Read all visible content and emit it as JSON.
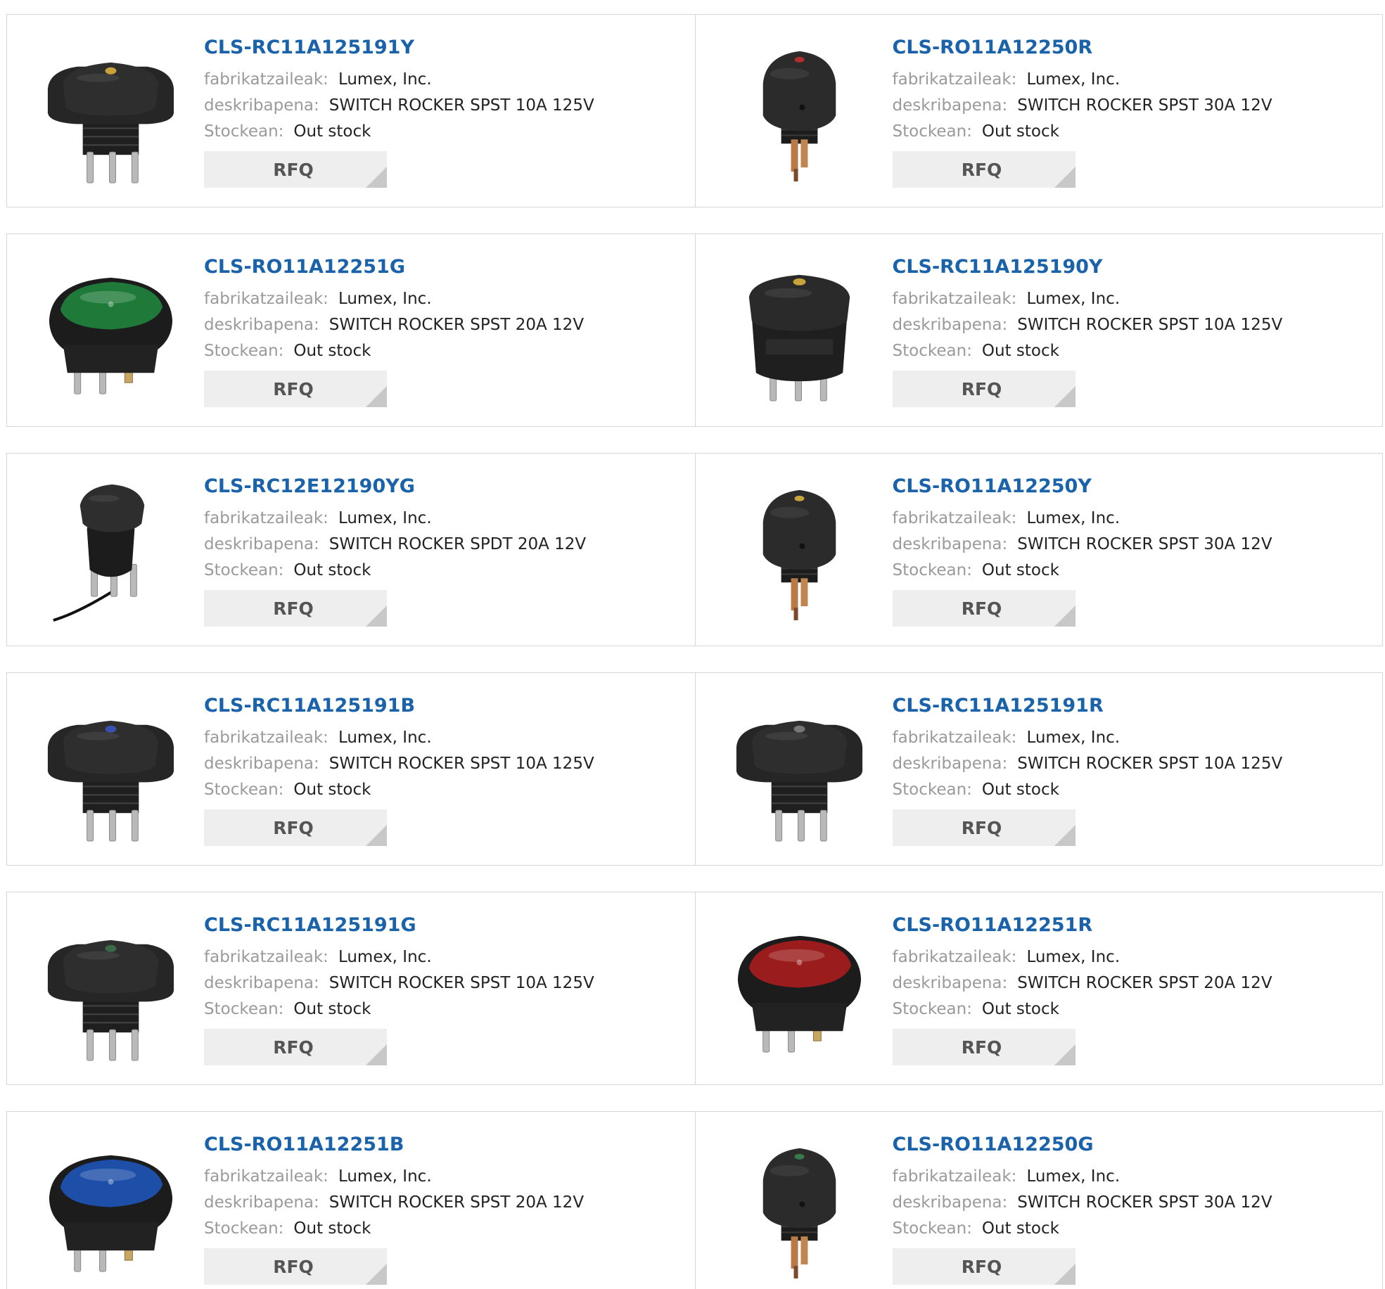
{
  "labels": {
    "manufacturer": "fabrikatzaileak:",
    "description": "deskribapena:",
    "stock": "Stockean:",
    "rfq": "RFQ"
  },
  "products": [
    {
      "part": "CLS-RC11A125191Y",
      "manufacturer": "Lumex, Inc.",
      "description": "SWITCH ROCKER SPST 10A 125V",
      "stock": "Out stock",
      "image": {
        "style": "round-bezel",
        "rocker_color": "#2e2e2e",
        "indicator": "#c8a23a"
      }
    },
    {
      "part": "CLS-RO11A12250R",
      "manufacturer": "Lumex, Inc.",
      "description": "SWITCH ROCKER SPST 30A 12V",
      "stock": "Out stock",
      "image": {
        "style": "oval-small",
        "rocker_color": "#2b2b2b",
        "indicator": "#b03030"
      }
    },
    {
      "part": "CLS-RO11A12251G",
      "manufacturer": "Lumex, Inc.",
      "description": "SWITCH ROCKER SPST 20A 12V",
      "stock": "Out stock",
      "image": {
        "style": "oval-lit",
        "rocker_color": "#1f7a3a",
        "indicator": "#1f7a3a"
      }
    },
    {
      "part": "CLS-RC11A125190Y",
      "manufacturer": "Lumex, Inc.",
      "description": "SWITCH ROCKER SPST 10A 125V",
      "stock": "Out stock",
      "image": {
        "style": "round-body",
        "rocker_color": "#2e2e2e",
        "indicator": "#c8a23a"
      }
    },
    {
      "part": "CLS-RC12E12190YG",
      "manufacturer": "Lumex, Inc.",
      "description": "SWITCH ROCKER SPDT 20A 12V",
      "stock": "Out stock",
      "image": {
        "style": "round-wire",
        "rocker_color": "#2e2e2e",
        "indicator": "#2e2e2e"
      }
    },
    {
      "part": "CLS-RO11A12250Y",
      "manufacturer": "Lumex, Inc.",
      "description": "SWITCH ROCKER SPST 30A 12V",
      "stock": "Out stock",
      "image": {
        "style": "oval-small",
        "rocker_color": "#2b2b2b",
        "indicator": "#c8a23a"
      }
    },
    {
      "part": "CLS-RC11A125191B",
      "manufacturer": "Lumex, Inc.",
      "description": "SWITCH ROCKER SPST 10A 125V",
      "stock": "Out stock",
      "image": {
        "style": "round-bezel",
        "rocker_color": "#2e2e2e",
        "indicator": "#3a4fae"
      }
    },
    {
      "part": "CLS-RC11A125191R",
      "manufacturer": "Lumex, Inc.",
      "description": "SWITCH ROCKER SPST 10A 125V",
      "stock": "Out stock",
      "image": {
        "style": "round-bezel",
        "rocker_color": "#2e2e2e",
        "indicator": "#777777"
      }
    },
    {
      "part": "CLS-RC11A125191G",
      "manufacturer": "Lumex, Inc.",
      "description": "SWITCH ROCKER SPST 10A 125V",
      "stock": "Out stock",
      "image": {
        "style": "round-bezel",
        "rocker_color": "#2e2e2e",
        "indicator": "#3a6a48"
      }
    },
    {
      "part": "CLS-RO11A12251R",
      "manufacturer": "Lumex, Inc.",
      "description": "SWITCH ROCKER SPST 20A 12V",
      "stock": "Out stock",
      "image": {
        "style": "oval-lit",
        "rocker_color": "#9a1c1c",
        "indicator": "#9a1c1c"
      }
    },
    {
      "part": "CLS-RO11A12251B",
      "manufacturer": "Lumex, Inc.",
      "description": "SWITCH ROCKER SPST 20A 12V",
      "stock": "Out stock",
      "image": {
        "style": "oval-lit",
        "rocker_color": "#1d4fa8",
        "indicator": "#1d4fa8"
      }
    },
    {
      "part": "CLS-RO11A12250G",
      "manufacturer": "Lumex, Inc.",
      "description": "SWITCH ROCKER SPST 30A 12V",
      "stock": "Out stock",
      "image": {
        "style": "oval-small",
        "rocker_color": "#2b2b2b",
        "indicator": "#3a7a48"
      }
    }
  ]
}
